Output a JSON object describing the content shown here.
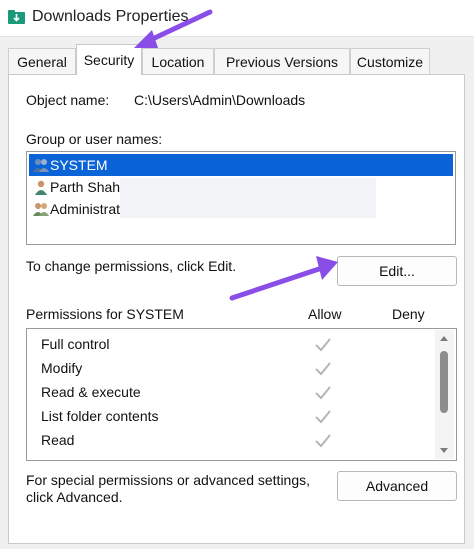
{
  "window": {
    "title": "Downloads Properties"
  },
  "tabs": [
    {
      "label": "General",
      "active": false
    },
    {
      "label": "Security",
      "active": true
    },
    {
      "label": "Location",
      "active": false
    },
    {
      "label": "Previous Versions",
      "active": false
    },
    {
      "label": "Customize",
      "active": false
    }
  ],
  "object": {
    "label": "Object name:",
    "value": "C:\\Users\\Admin\\Downloads"
  },
  "groups": {
    "label": "Group or user names:",
    "items": [
      {
        "name": "SYSTEM",
        "selected": true,
        "icon": "users-group-icon"
      },
      {
        "name": "Parth Shah",
        "selected": false,
        "icon": "user-icon"
      },
      {
        "name": "Administrato",
        "selected": false,
        "icon": "admin-group-icon"
      }
    ]
  },
  "change_text": "To change permissions, click Edit.",
  "edit_button": "Edit...",
  "permissions": {
    "label": "Permissions for SYSTEM",
    "allow_label": "Allow",
    "deny_label": "Deny",
    "rows": [
      {
        "name": "Full control",
        "allow": true
      },
      {
        "name": "Modify",
        "allow": true
      },
      {
        "name": "Read & execute",
        "allow": true
      },
      {
        "name": "List folder contents",
        "allow": true
      },
      {
        "name": "Read",
        "allow": true
      }
    ]
  },
  "special": {
    "line1": "For special permissions or advanced settings,",
    "line2": "click Advanced."
  },
  "advanced_button": "Advanced",
  "colors": {
    "accent": "#0a64d8",
    "annotation_arrow": "#8a4ee8",
    "check": "#b5b5b5"
  }
}
